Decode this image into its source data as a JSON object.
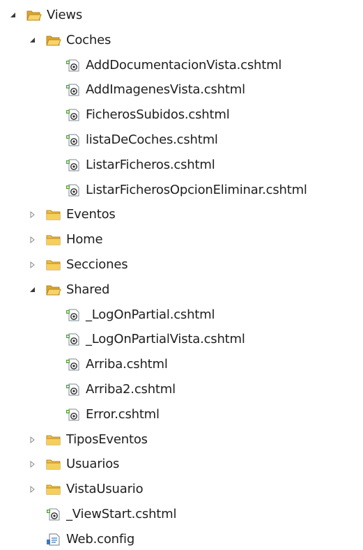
{
  "solution_explorer": {
    "tree": [
      {
        "id": "views",
        "label": "Views",
        "type": "folder",
        "expanded": true,
        "depth": 0
      },
      {
        "id": "coches",
        "label": "Coches",
        "type": "folder",
        "expanded": true,
        "depth": 1
      },
      {
        "id": "c1",
        "label": "AddDocumentacionVista.cshtml",
        "type": "cshtml",
        "depth": 2
      },
      {
        "id": "c2",
        "label": "AddImagenesVista.cshtml",
        "type": "cshtml",
        "depth": 2
      },
      {
        "id": "c3",
        "label": "FicherosSubidos.cshtml",
        "type": "cshtml",
        "depth": 2
      },
      {
        "id": "c4",
        "label": "listaDeCoches.cshtml",
        "type": "cshtml",
        "depth": 2
      },
      {
        "id": "c5",
        "label": "ListarFicheros.cshtml",
        "type": "cshtml",
        "depth": 2
      },
      {
        "id": "c6",
        "label": "ListarFicherosOpcionEliminar.cshtml",
        "type": "cshtml",
        "depth": 2
      },
      {
        "id": "eventos",
        "label": "Eventos",
        "type": "folder",
        "expanded": false,
        "depth": 1
      },
      {
        "id": "home",
        "label": "Home",
        "type": "folder",
        "expanded": false,
        "depth": 1
      },
      {
        "id": "secciones",
        "label": "Secciones",
        "type": "folder",
        "expanded": false,
        "depth": 1
      },
      {
        "id": "shared",
        "label": "Shared",
        "type": "folder",
        "expanded": true,
        "depth": 1
      },
      {
        "id": "s1",
        "label": "_LogOnPartial.cshtml",
        "type": "cshtml",
        "depth": 2
      },
      {
        "id": "s2",
        "label": "_LogOnPartialVista.cshtml",
        "type": "cshtml",
        "depth": 2
      },
      {
        "id": "s3",
        "label": "Arriba.cshtml",
        "type": "cshtml",
        "depth": 2
      },
      {
        "id": "s4",
        "label": "Arriba2.cshtml",
        "type": "cshtml",
        "depth": 2
      },
      {
        "id": "s5",
        "label": "Error.cshtml",
        "type": "cshtml",
        "depth": 2
      },
      {
        "id": "tiposeventos",
        "label": "TiposEventos",
        "type": "folder",
        "expanded": false,
        "depth": 1
      },
      {
        "id": "usuarios",
        "label": "Usuarios",
        "type": "folder",
        "expanded": false,
        "depth": 1
      },
      {
        "id": "vistausuario",
        "label": "VistaUsuario",
        "type": "folder",
        "expanded": false,
        "depth": 1
      },
      {
        "id": "viewstart",
        "label": "_ViewStart.cshtml",
        "type": "cshtml",
        "depth": 1
      },
      {
        "id": "webconfig",
        "label": "Web.config",
        "type": "config",
        "depth": 1
      }
    ]
  },
  "colors": {
    "folder_body": "#f0c24a",
    "folder_tab": "#d9a631",
    "folder_outline": "#b8861d",
    "folder_open_front": "#f7d46b",
    "toggle_expanded": "#3a3a3a",
    "toggle_collapsed": "#8a8a8a",
    "file_green": "#5aa543",
    "text": "#1e1e1e"
  },
  "icons": {
    "folder": "folder-icon",
    "folder_open": "folder-open-icon",
    "cshtml": "razor-file-icon",
    "config": "config-file-icon",
    "expanded": "triangle-expanded-icon",
    "collapsed": "triangle-collapsed-icon"
  }
}
